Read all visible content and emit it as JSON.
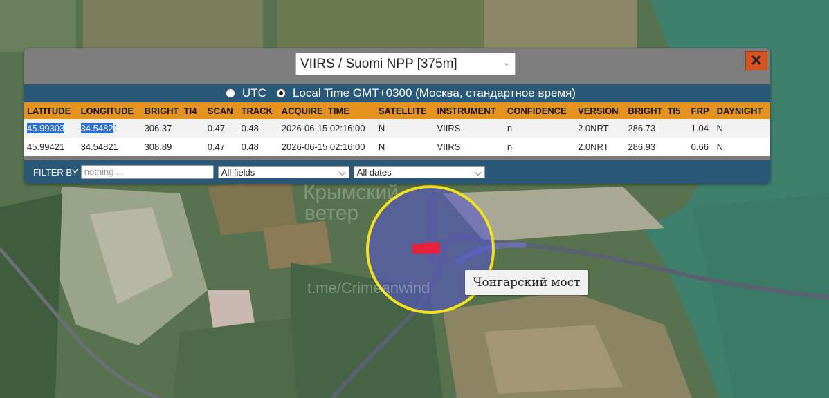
{
  "dataset_select": {
    "value": "VIIRS / Suomi NPP [375m]"
  },
  "close": {
    "label": "✕"
  },
  "time_mode": {
    "utc_label": "UTC",
    "local_label": "Local Time GMT+0300 (Москва, стандартное время)",
    "selected": "local"
  },
  "table": {
    "columns": [
      "LATITUDE",
      "LONGITUDE",
      "BRIGHT_TI4",
      "SCAN",
      "TRACK",
      "ACQUIRE_TIME",
      "SATELLITE",
      "INSTRUMENT",
      "CONFIDENCE",
      "VERSION",
      "BRIGHT_TI5",
      "FRP",
      "DAYNIGHT"
    ],
    "rows": [
      {
        "lat_sel": "45.99303",
        "lon_sel": "34.5482",
        "lon_rest": "1",
        "bright_ti4": "306.37",
        "scan": "0.47",
        "track": "0.48",
        "acquire_time": "2026-06-15 02:16:00",
        "satellite": "N",
        "instrument": "VIIRS",
        "confidence": "n",
        "version": "2.0NRT",
        "bright_ti5": "286.73",
        "frp": "1.04",
        "daynight": "N"
      },
      {
        "lat": "45.99421",
        "lon": "34.54821",
        "bright_ti4": "308.89",
        "scan": "0.47",
        "track": "0.48",
        "acquire_time": "2026-06-15 02:16:00",
        "satellite": "N",
        "instrument": "VIIRS",
        "confidence": "n",
        "version": "2.0NRT",
        "bright_ti5": "286.93",
        "frp": "0.66",
        "daynight": "N"
      }
    ]
  },
  "filter": {
    "label": "FILTER BY",
    "placeholder": "nothing ...",
    "field_select": "All fields",
    "date_select": "All dates"
  },
  "map": {
    "watermark_line1": "Крымский",
    "watermark_line2": "ветер",
    "watermark_link": "t.me/Crimeanwind",
    "bridge_label": "Чонгарский мост"
  },
  "colors": {
    "header_bar": "#e5931e",
    "band": "#2a5878",
    "highlight_circle": "#f2e21a",
    "hotspot": "#e8203a"
  }
}
